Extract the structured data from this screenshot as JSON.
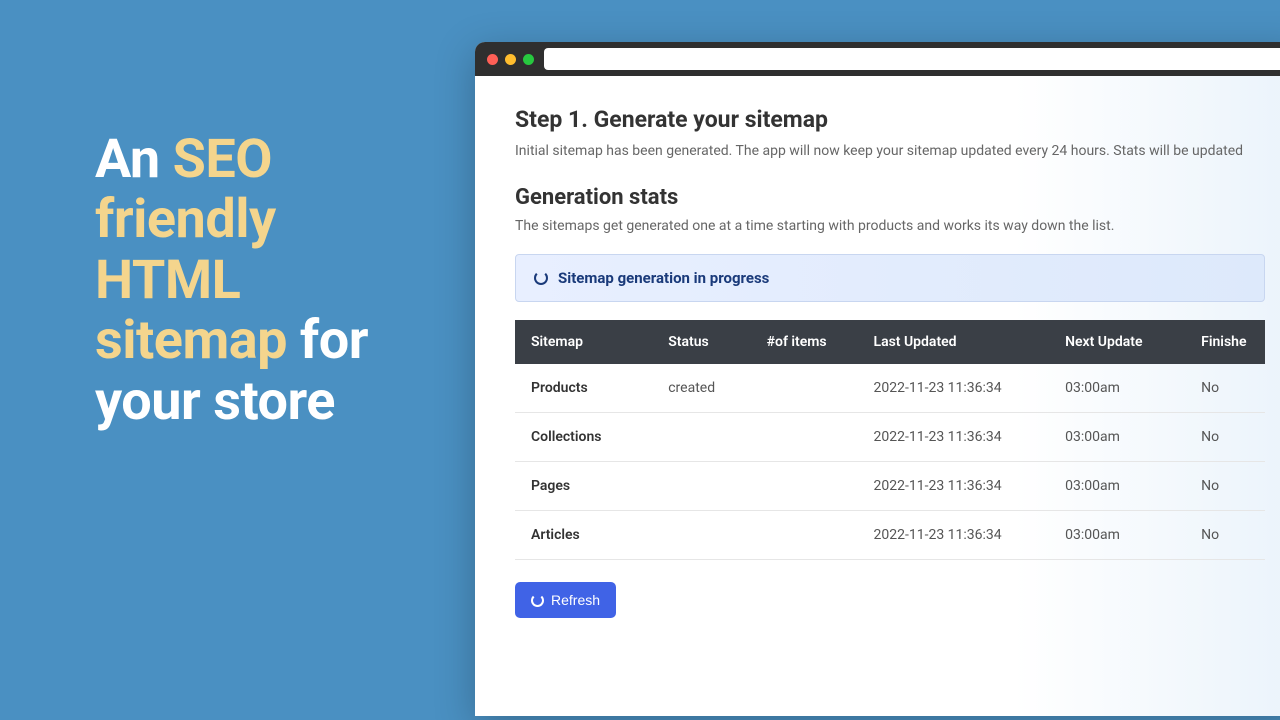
{
  "marketing": {
    "line1_pre": "An ",
    "line1_accent": "SEO friendly",
    "line2_accent": "HTML sitemap",
    "line3_plain": " for your store"
  },
  "page": {
    "step_title": "Step 1. Generate your sitemap",
    "step_desc": "Initial sitemap has been generated. The app will now keep your sitemap updated every 24 hours. Stats will be updated",
    "stats_title": "Generation stats",
    "stats_desc": "The sitemaps get generated one at a time starting with products and works its way down the list.",
    "progress_text": "Sitemap generation in progress",
    "refresh_label": "Refresh"
  },
  "table": {
    "headers": {
      "sitemap": "Sitemap",
      "status": "Status",
      "items": "#of items",
      "last": "Last Updated",
      "next": "Next Update",
      "finished": "Finishe"
    },
    "rows": [
      {
        "sitemap": "Products",
        "status": "created",
        "items": "",
        "last": "2022-11-23 11:36:34",
        "next": "03:00am",
        "finished": "No"
      },
      {
        "sitemap": "Collections",
        "status": "",
        "items": "",
        "last": "2022-11-23 11:36:34",
        "next": "03:00am",
        "finished": "No"
      },
      {
        "sitemap": "Pages",
        "status": "",
        "items": "",
        "last": "2022-11-23 11:36:34",
        "next": "03:00am",
        "finished": "No"
      },
      {
        "sitemap": "Articles",
        "status": "",
        "items": "",
        "last": "2022-11-23 11:36:34",
        "next": "03:00am",
        "finished": "No"
      }
    ]
  },
  "colors": {
    "background": "#4a90c2",
    "accent_text": "#f4d58d",
    "button": "#4063e6",
    "banner_text": "#1a3a7a"
  }
}
